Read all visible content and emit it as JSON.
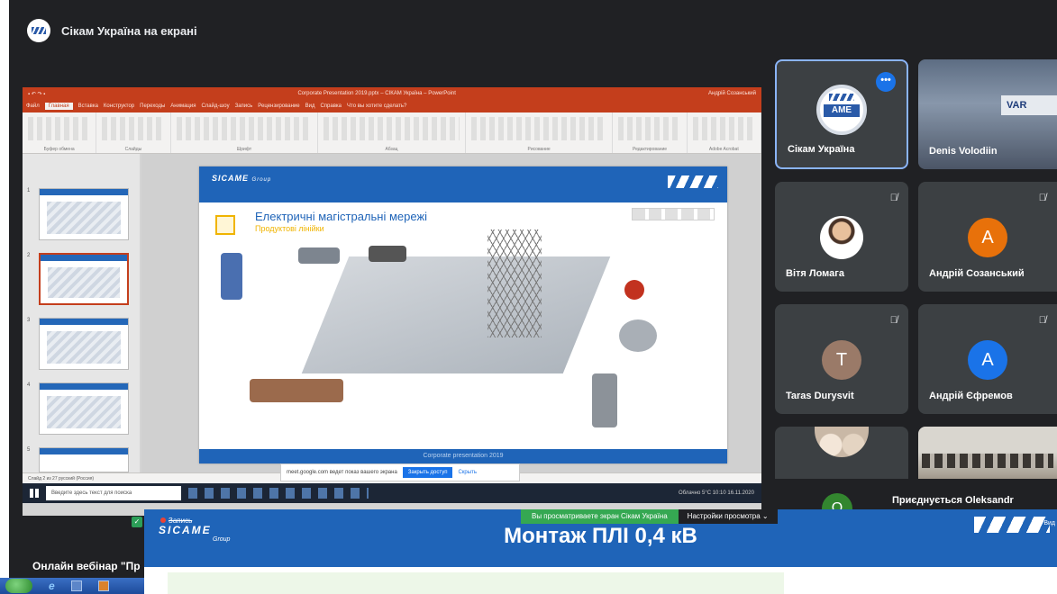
{
  "presenter": {
    "title": "Сікам Україна на екрані"
  },
  "powerpoint": {
    "window_title": "Corporate Presentation 2019.pptx – СІКАМ Україна – PowerPoint",
    "user": "Андрій Созанський",
    "tabs": [
      "Файл",
      "Главная",
      "Вставка",
      "Конструктор",
      "Переходы",
      "Анимация",
      "Слайд-шоу",
      "Запись",
      "Рецензирование",
      "Вид",
      "Справка"
    ],
    "active_tab": "Главная",
    "tell_me": "Что вы хотите сделать?",
    "ribbon_groups": [
      "Буфер обмена",
      "Слайды",
      "Шрифт",
      "Абзац",
      "Рисование",
      "Редактирование",
      "Adobe Acrobat"
    ],
    "thumbnail_numbers": [
      "1",
      "2",
      "3",
      "4",
      "5"
    ],
    "status_text": "Слайд 2 из 27   русский (Россия)",
    "slide": {
      "title": "Електричні магістральні мережі",
      "subtitle": "Продуктові лінійки",
      "logo": "SICAME",
      "logo_sub": "Group",
      "footer": "Corporate presentation 2019"
    }
  },
  "share_notice": {
    "text": "meet.google.com ведет показ вашего экрана",
    "stop_button": "Закрыть доступ",
    "hide_button": "Скрыть"
  },
  "windows_taskbar": {
    "search_placeholder": "Введите здесь текст для поиска",
    "tray": "Облачно  5°C  10:10  16.11.2020"
  },
  "participants": [
    {
      "name": "Сікам Україна",
      "kind": "logo",
      "logo_text": "AME",
      "selected": true
    },
    {
      "name": "Denis Volodiin",
      "kind": "photo"
    },
    {
      "name": "Вітя Ломага",
      "kind": "photo",
      "muted": true
    },
    {
      "name": "Андрій Созанський",
      "kind": "avatar",
      "initial": "A",
      "color": "#e8710a",
      "muted": true
    },
    {
      "name": "Taras Durysvit",
      "kind": "avatar",
      "initial": "T",
      "color": "#9a7a68",
      "muted": true
    },
    {
      "name": "Андрій Єфремов",
      "kind": "avatar",
      "initial": "A",
      "color": "#1a73e8",
      "muted": true
    }
  ],
  "joins": {
    "initial": "O",
    "text": "Приєднується Oleksandr"
  },
  "viewing_bar": {
    "message": "Вы просматриваете экран Сікам Україна",
    "options_label": "Настройки просмотра",
    "options_caret": "⌄"
  },
  "webinar": {
    "record_label": "Запись",
    "title": "Монтаж ПЛІ 0,4 кВ",
    "logo": "SICAME",
    "logo_sub": "Group",
    "right_label": "Вид",
    "caption": "Онлайн вебінар \"Пр"
  },
  "colors": {
    "meet_bg": "#202124",
    "tile_bg": "#3c4043",
    "selected_border": "#8ab4f8",
    "sicame_blue": "#1f64b8",
    "ppt_red": "#c43e1c",
    "viewing_green": "#35a852"
  },
  "icons": {
    "muted": "mic-off-icon",
    "more": "more-options-icon",
    "shield": "shield-icon"
  }
}
